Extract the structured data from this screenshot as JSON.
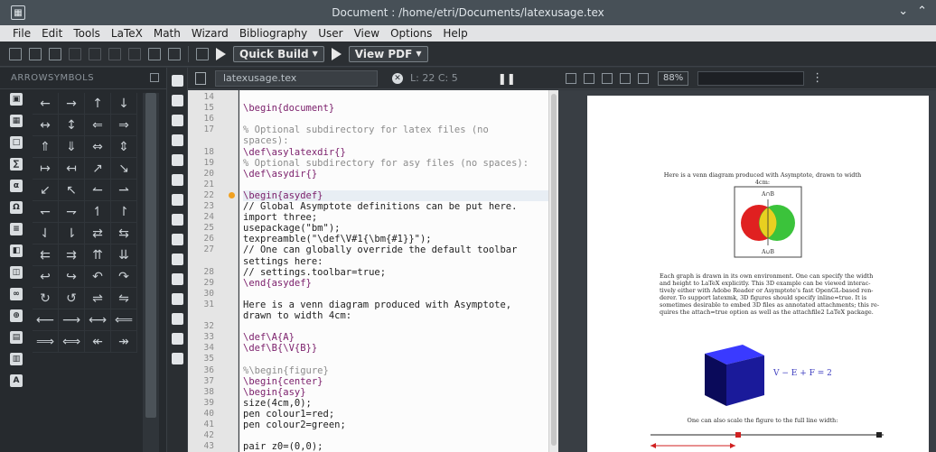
{
  "window": {
    "title": "Document : /home/etri/Documents/latexusage.tex",
    "app_icon": "document-icon",
    "controls": [
      "minimize-icon",
      "maximize-icon"
    ]
  },
  "menu": [
    "File",
    "Edit",
    "Tools",
    "LaTeX",
    "Math",
    "Wizard",
    "Bibliography",
    "User",
    "View",
    "Options",
    "Help"
  ],
  "toolbar": {
    "build_label": "Quick Build",
    "view_label": "View PDF"
  },
  "symbols_panel": {
    "title": "ARROWSYMBOLS",
    "symbols": [
      "←",
      "→",
      "↑",
      "↓",
      "↔",
      "↕",
      "⇐",
      "⇒",
      "⇑",
      "⇓",
      "⇔",
      "⇕",
      "↦",
      "↤",
      "↗",
      "↘",
      "↙",
      "↖",
      "↼",
      "⇀",
      "↽",
      "⇁",
      "↿",
      "↾",
      "⇃",
      "⇂",
      "⇄",
      "⇆",
      "⇇",
      "⇉",
      "⇈",
      "⇊",
      "↩",
      "↪",
      "↶",
      "↷",
      "↻",
      "↺",
      "⇌",
      "⇋",
      "⟵",
      "⟶",
      "⟷",
      "⟸",
      "⟹",
      "⟺",
      "↞",
      "↠"
    ]
  },
  "editor": {
    "tab_label": "latexusage.tex",
    "cursor_pos": "L: 22 C: 5",
    "lines": [
      {
        "n": "14",
        "text": ""
      },
      {
        "n": "15",
        "text": "\\begin{document}",
        "cls": "kw"
      },
      {
        "n": "16",
        "text": ""
      },
      {
        "n": "17",
        "text": "% Optional subdirectory for latex files (no",
        "cls": "comment"
      },
      {
        "n": "",
        "text": "spaces):",
        "cls": "comment"
      },
      {
        "n": "18",
        "text": "\\def\\asylatexdir{}",
        "cls": "kw"
      },
      {
        "n": "19",
        "text": "% Optional subdirectory for asy files (no spaces):",
        "cls": "comment"
      },
      {
        "n": "20",
        "text": "\\def\\asydir{}",
        "cls": "kw"
      },
      {
        "n": "21",
        "text": ""
      },
      {
        "n": "22",
        "text": "\\begin{asydef}",
        "cls": "kw",
        "cur": true
      },
      {
        "n": "23",
        "text": "// Global Asymptote definitions can be put here."
      },
      {
        "n": "24",
        "text": "import three;"
      },
      {
        "n": "25",
        "text": "usepackage(\"bm\");"
      },
      {
        "n": "26",
        "text": "texpreamble(\"\\def\\V#1{\\bm{#1}}\");"
      },
      {
        "n": "27",
        "text": "// One can globally override the default toolbar"
      },
      {
        "n": "",
        "text": "settings here:"
      },
      {
        "n": "28",
        "text": "// settings.toolbar=true;"
      },
      {
        "n": "29",
        "text": "\\end{asydef}",
        "cls": "kw"
      },
      {
        "n": "30",
        "text": ""
      },
      {
        "n": "31",
        "text": "Here is a venn diagram produced with Asymptote,"
      },
      {
        "n": "",
        "text": "drawn to width 4cm:"
      },
      {
        "n": "32",
        "text": ""
      },
      {
        "n": "33",
        "text": "\\def\\A{A}",
        "cls": "kw"
      },
      {
        "n": "34",
        "text": "\\def\\B{\\V{B}}",
        "cls": "kw"
      },
      {
        "n": "35",
        "text": ""
      },
      {
        "n": "36",
        "text": "%\\begin{figure}",
        "cls": "comment"
      },
      {
        "n": "37",
        "text": "\\begin{center}",
        "cls": "kw"
      },
      {
        "n": "38",
        "text": "\\begin{asy}",
        "cls": "kw"
      },
      {
        "n": "39",
        "text": "size(4cm,0);"
      },
      {
        "n": "40",
        "text": "pen colour1=red;"
      },
      {
        "n": "41",
        "text": "pen colour2=green;"
      },
      {
        "n": "42",
        "text": ""
      },
      {
        "n": "43",
        "text": "pair z0=(0,0);"
      }
    ]
  },
  "viewer": {
    "zoom": "88%",
    "caption1": "Here is a venn diagram produced with Asymptote, drawn to width 4cm:",
    "venn_label_top": "A∩B",
    "venn_label_bottom": "A∪B",
    "para": [
      "Each graph is drawn in its own environment. One can specify the width",
      "and height to LaTeX explicitly. This 3D example can be viewed interac-",
      "tively either with Adobe Reader or Asymptote's fast OpenGL-based ren-",
      "derer. To support latexmk, 3D figures should specify inline=true. It is",
      "sometimes desirable to embed 3D files as annotated attachments; this re-",
      "quires the attach=true option as well as the attachfile2 LaTeX package."
    ],
    "euler": "V − E + F = 2",
    "caption2": "One can also scale the figure to the full line width:"
  },
  "colors": {
    "titlebar": "#475057",
    "menubar": "#e2e3e5",
    "panel_dark": "#262a2e",
    "editor_bg": "#fcfcfc",
    "venn_red": "#e02020",
    "venn_green": "#30c030",
    "cube_blue": "#1a1a9a"
  }
}
